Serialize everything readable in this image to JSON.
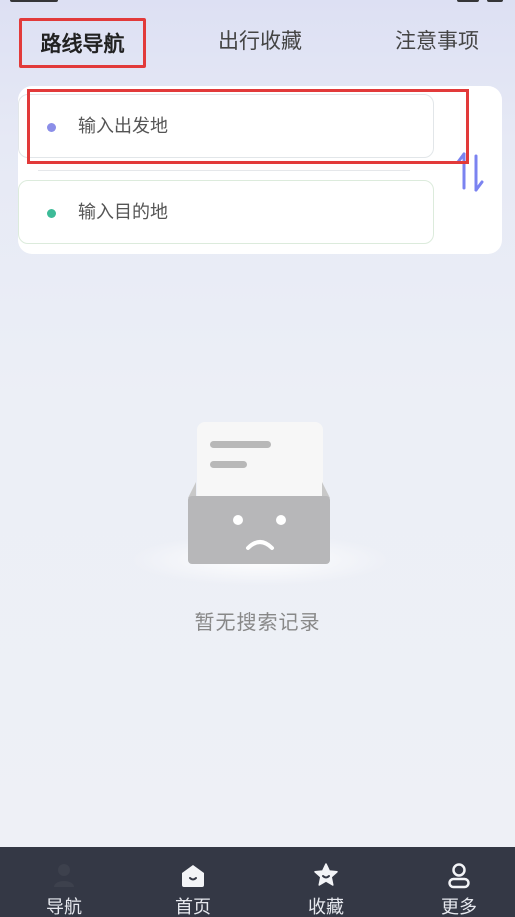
{
  "tabs": [
    {
      "label": "路线导航",
      "active": true
    },
    {
      "label": "出行收藏",
      "active": false
    },
    {
      "label": "注意事项",
      "active": false
    }
  ],
  "route": {
    "start_placeholder": "输入出发地",
    "end_placeholder": "输入目的地",
    "start_dot_color": "#8b8ee8",
    "end_dot_color": "#3dbb98",
    "swap_icon": "swap-vertical-icon"
  },
  "empty_state": {
    "icon": "empty-box-icon",
    "text": "暂无搜索记录"
  },
  "bottom_nav": [
    {
      "label": "导航",
      "icon": "person-icon",
      "active": true
    },
    {
      "label": "首页",
      "icon": "home-icon",
      "active": false
    },
    {
      "label": "收藏",
      "icon": "star-icon",
      "active": false
    },
    {
      "label": "更多",
      "icon": "profile-icon",
      "active": false
    }
  ],
  "colors": {
    "highlight": "#e23a3a",
    "nav_background": "#343845",
    "accent": "#7b83f0"
  }
}
